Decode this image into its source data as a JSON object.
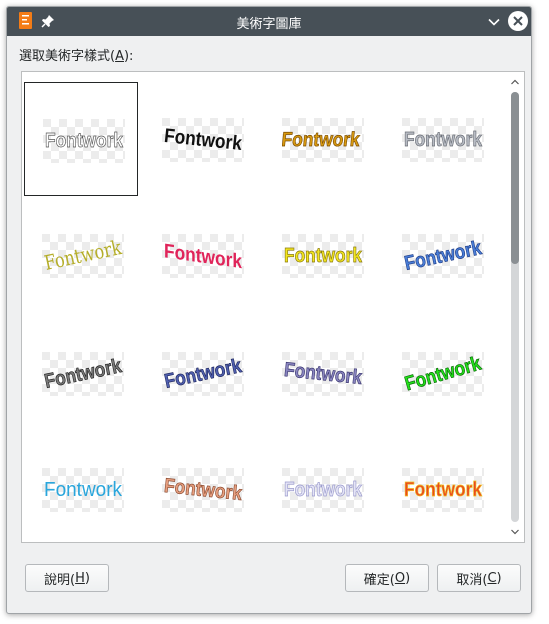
{
  "window": {
    "title": "美術字圖庫"
  },
  "titlebar_icons": [
    "app-icon",
    "pin-icon",
    "chevron-down-icon",
    "close-icon"
  ],
  "dialog": {
    "select_label_prefix": "選取美術字樣式(",
    "select_label_key": "A",
    "select_label_suffix": "):"
  },
  "gallery": {
    "item_text": "Fontwork",
    "selected_index": 0,
    "styles": [
      {
        "name": "outline-shadow",
        "fill": "#ffffff",
        "stroke": "#555555"
      },
      {
        "name": "black-arch",
        "fill": "#111111",
        "stroke": "none"
      },
      {
        "name": "gold-gradient",
        "fill": "#d89a10",
        "stroke": "#7a4a00"
      },
      {
        "name": "grey-3d",
        "fill": "#b8bcc4",
        "stroke": "#6a6e76"
      },
      {
        "name": "olive-italic",
        "fill": "#b5ae2a",
        "stroke": "none"
      },
      {
        "name": "red-stripes",
        "fill": "#e0245a",
        "stroke": "none"
      },
      {
        "name": "yellow-bold",
        "fill": "#f2e61e",
        "stroke": "#8a7a10"
      },
      {
        "name": "blue-slant",
        "fill": "#4a7ed8",
        "stroke": "#22408a"
      },
      {
        "name": "grey-extrude",
        "fill": "#7a7a7a",
        "stroke": "#222222"
      },
      {
        "name": "navy-shadow",
        "fill": "#5060b0",
        "stroke": "#202860"
      },
      {
        "name": "purple-wave",
        "fill": "#8a86c0",
        "stroke": "#3a3670"
      },
      {
        "name": "green-curve",
        "fill": "#22e01a",
        "stroke": "#0b6a08"
      },
      {
        "name": "cyan-plain",
        "fill": "#2aa6dc",
        "stroke": "none"
      },
      {
        "name": "salmon-arch",
        "fill": "#e8a080",
        "stroke": "#8a4a30"
      },
      {
        "name": "lavender-outline",
        "fill": "#e4e4f6",
        "stroke": "#9a9acc"
      },
      {
        "name": "red-gradient",
        "fill": "#ea4a20",
        "stroke": "#f0c020"
      }
    ]
  },
  "buttons": {
    "help_prefix": "說明(",
    "help_key": "H",
    "help_suffix": ")",
    "ok_prefix": "確定(",
    "ok_key": "O",
    "ok_suffix": ")",
    "cancel_prefix": "取消(",
    "cancel_key": "C",
    "cancel_suffix": ")"
  },
  "colors": {
    "titlebar": "#475057",
    "window_bg": "#eff0f1",
    "scroll_thumb": "#8a8f93"
  },
  "scroll": {
    "visible_fraction": 0.4
  }
}
